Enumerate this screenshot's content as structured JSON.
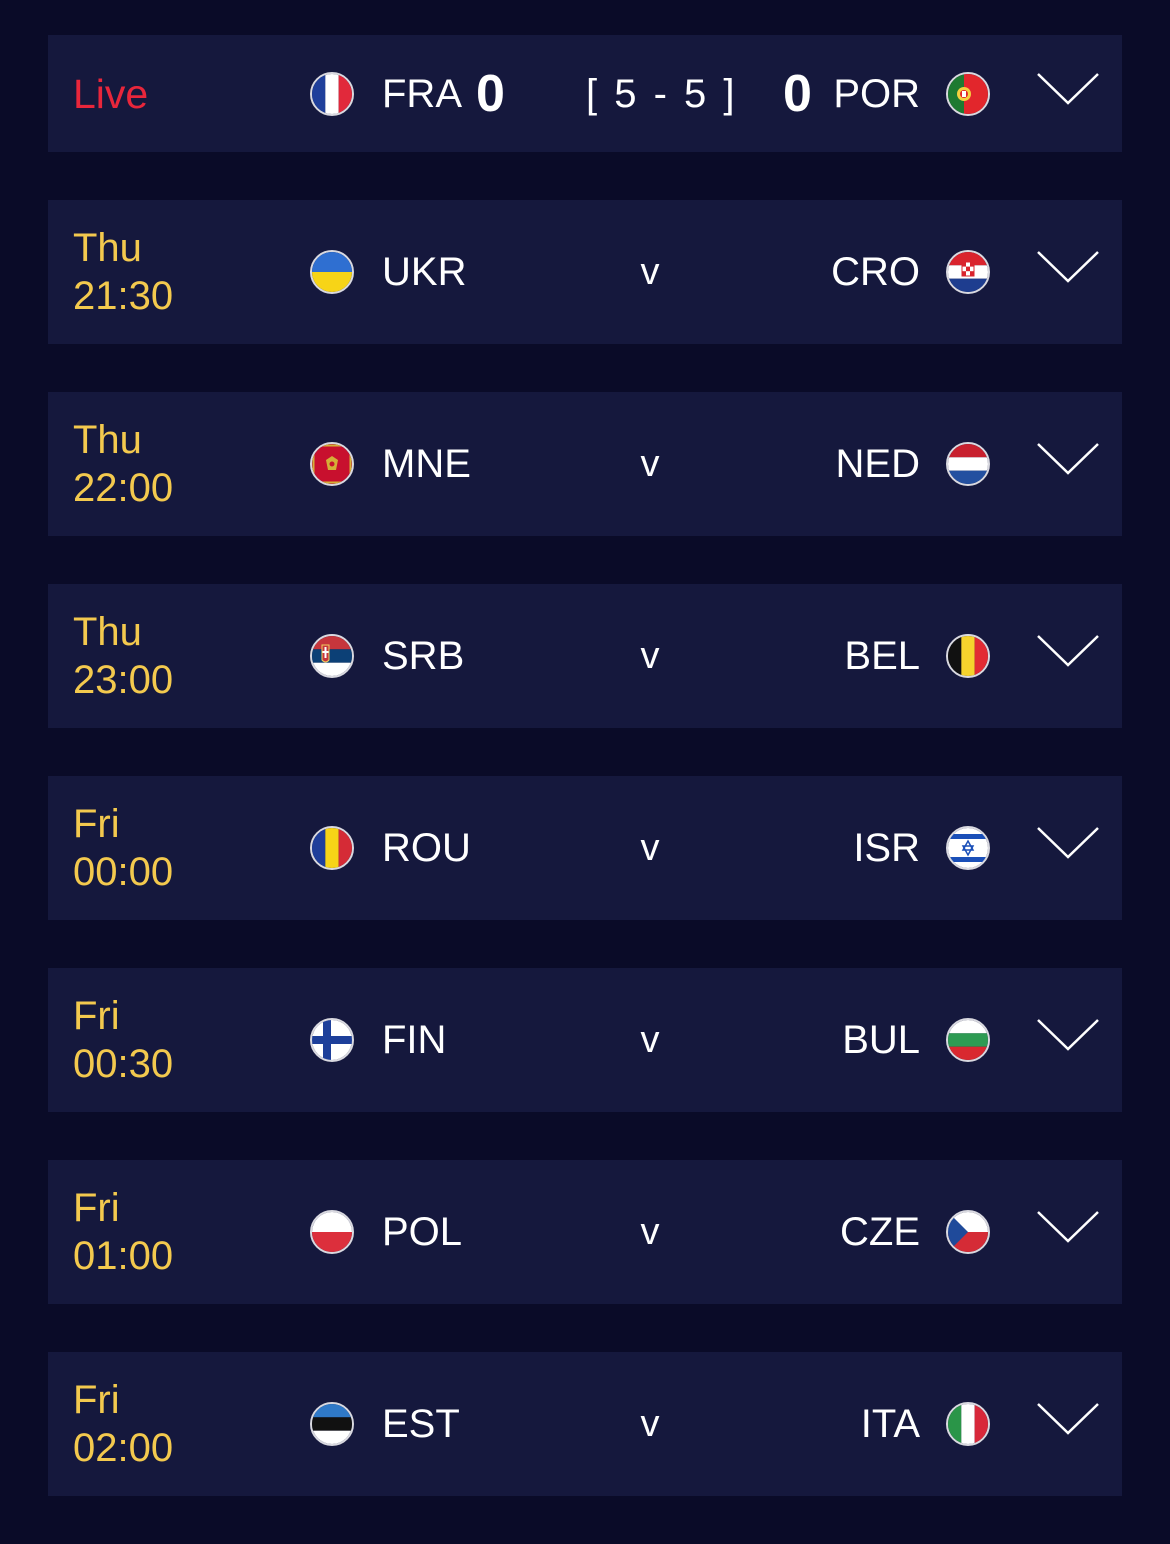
{
  "live_match": {
    "status": "Live",
    "home": {
      "code": "FRA",
      "score": "0",
      "flag": "flag-france"
    },
    "away": {
      "code": "POR",
      "score": "0",
      "flag": "flag-portugal"
    },
    "aggregate": "[ 5 - 5 ]"
  },
  "fixtures": [
    {
      "day": "Thu",
      "time": "21:30",
      "home": "UKR",
      "away": "CRO",
      "home_flag": "flag-ukraine",
      "away_flag": "flag-croatia",
      "separator": "v"
    },
    {
      "day": "Thu",
      "time": "22:00",
      "home": "MNE",
      "away": "NED",
      "home_flag": "flag-montenegro",
      "away_flag": "flag-netherlands",
      "separator": "v"
    },
    {
      "day": "Thu",
      "time": "23:00",
      "home": "SRB",
      "away": "BEL",
      "home_flag": "flag-serbia",
      "away_flag": "flag-belgium",
      "separator": "v"
    },
    {
      "day": "Fri",
      "time": "00:00",
      "home": "ROU",
      "away": "ISR",
      "home_flag": "flag-romania",
      "away_flag": "flag-israel",
      "separator": "v"
    },
    {
      "day": "Fri",
      "time": "00:30",
      "home": "FIN",
      "away": "BUL",
      "home_flag": "flag-finland",
      "away_flag": "flag-bulgaria",
      "separator": "v"
    },
    {
      "day": "Fri",
      "time": "01:00",
      "home": "POL",
      "away": "CZE",
      "home_flag": "flag-poland",
      "away_flag": "flag-czechia",
      "separator": "v"
    },
    {
      "day": "Fri",
      "time": "02:00",
      "home": "EST",
      "away": "ITA",
      "home_flag": "flag-estonia",
      "away_flag": "flag-italy",
      "separator": "v"
    }
  ],
  "icons": {
    "expand": "chevron-down-icon"
  },
  "colors": {
    "background": "#0a0b28",
    "row_background": "#15183d",
    "live": "#e8263b",
    "kickoff_time": "#f3c94e",
    "text": "#ffffff"
  }
}
